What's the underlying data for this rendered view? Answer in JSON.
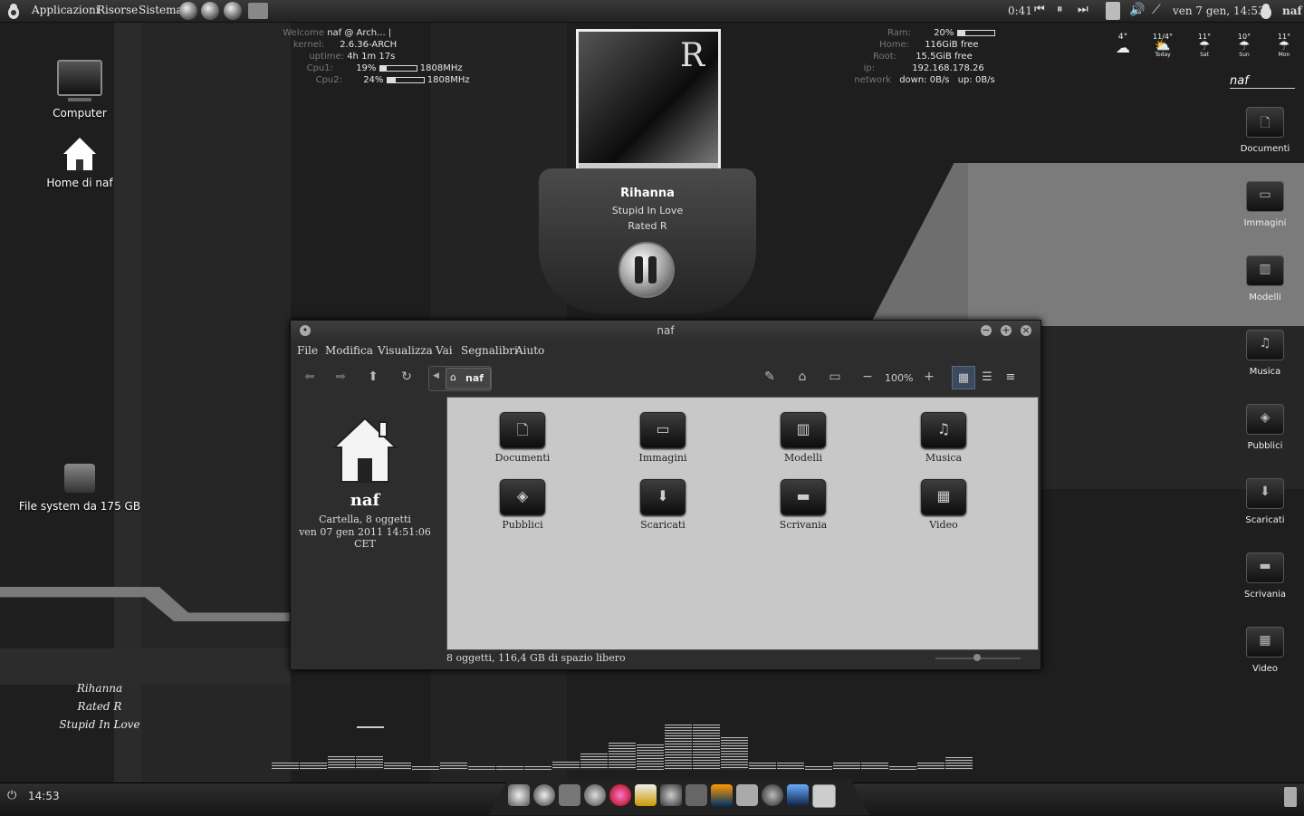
{
  "top_panel": {
    "menus": [
      "Applicazioni",
      "Risorse",
      "Sistema"
    ],
    "track_time": "0:41",
    "datetime": "ven  7 gen, 14:53",
    "user": "naf"
  },
  "conky_left": {
    "welcome_label": "Welcome",
    "welcome_value": "naf @ Arch... |",
    "kernel_label": "kernel:",
    "kernel_value": "2.6.36-ARCH",
    "uptime_label": "uptime:",
    "uptime_value": "4h 1m 17s",
    "cpu1_label": "Cpu1:",
    "cpu1_pct": "19%",
    "cpu1_freq": "1808MHz",
    "cpu1_level": 0.19,
    "cpu2_label": "Cpu2:",
    "cpu2_pct": "24%",
    "cpu2_freq": "1808MHz",
    "cpu2_level": 0.24
  },
  "conky_right": {
    "ram_label": "Ram:",
    "ram_value": "20%",
    "ram_level": 0.2,
    "home_label": "Home:",
    "home_value": "116GiB free",
    "root_label": "Root:",
    "root_value": "15.5GiB free",
    "ip_label": "ip:",
    "ip_value": "192.168.178.26",
    "network_label": "network",
    "down_value": "down: 0B/s",
    "up_value": "up: 0B/s"
  },
  "weather": {
    "days": [
      {
        "temp": "4°",
        "label": ""
      },
      {
        "temp": "11/4°",
        "label": "Today"
      },
      {
        "temp": "11°",
        "label": "Sat"
      },
      {
        "temp": "10°",
        "label": "Sun"
      },
      {
        "temp": "11°",
        "label": "Mon"
      }
    ],
    "user_label": "naf"
  },
  "desktop_icons": {
    "computer": "Computer",
    "home": "Home di naf",
    "filesystem": "File system da 175 GB"
  },
  "player": {
    "artist": "Rihanna",
    "title": "Stupid In Love",
    "album": "Rated R",
    "cover_letter": "R"
  },
  "right_launchers": [
    "Documenti",
    "Immagini",
    "Modelli",
    "Musica",
    "Pubblici",
    "Scaricati",
    "Scrivania",
    "Video"
  ],
  "file_manager": {
    "title": "naf",
    "menu": [
      "File",
      "Modifica",
      "Visualizza",
      "Vai",
      "Segnalibri",
      "Aiuto"
    ],
    "path": "naf",
    "zoom": "100%",
    "side": {
      "name": "naf",
      "info": "Cartella, 8 oggetti",
      "date": "ven 07 gen 2011 14:51:06 CET"
    },
    "items": [
      {
        "name": "Documenti",
        "glyph": "🗋"
      },
      {
        "name": "Immagini",
        "glyph": "▭"
      },
      {
        "name": "Modelli",
        "glyph": "▥"
      },
      {
        "name": "Musica",
        "glyph": "♫"
      },
      {
        "name": "Pubblici",
        "glyph": "◈"
      },
      {
        "name": "Scaricati",
        "glyph": "⬇"
      },
      {
        "name": "Scrivania",
        "glyph": "▬"
      },
      {
        "name": "Video",
        "glyph": "▦"
      }
    ],
    "status": "8 oggetti, 116,4 GB di spazio libero"
  },
  "lyrics": [
    "Rihanna",
    "Rated R",
    "Stupid In Love"
  ],
  "equalizer_levels": [
    0.15,
    0.15,
    0.3,
    0.3,
    0.15,
    0.08,
    0.15,
    0.08,
    0.08,
    0.08,
    0.18,
    0.35,
    0.6,
    0.55,
    1.0,
    1.0,
    0.72,
    0.15,
    0.15,
    0.08,
    0.15,
    0.15,
    0.08,
    0.15,
    0.28
  ],
  "bottom_panel": {
    "clock": "14:53"
  },
  "colors": {
    "panel": "#222222",
    "window_bg": "#2d2d2d",
    "content_bg": "#c8c8c8",
    "accent": "#3b4a5e"
  }
}
